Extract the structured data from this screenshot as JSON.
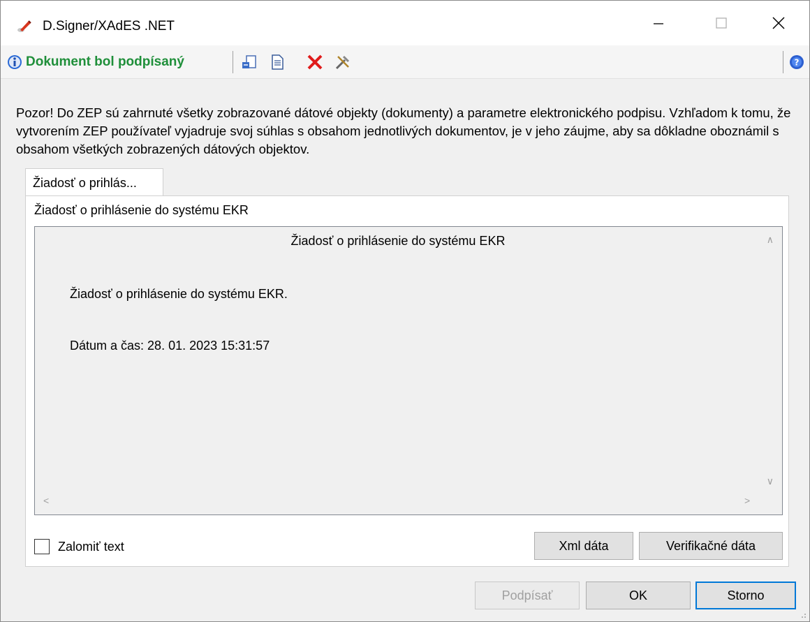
{
  "window": {
    "title": "D.Signer/XAdES .NET",
    "controls": {
      "minimize": "—",
      "maximize": "☐",
      "close": "✕"
    }
  },
  "toolbar": {
    "status_label": "Dokument bol podpísaný",
    "icons": [
      "import-icon",
      "document-icon",
      "delete-icon",
      "settings-icon",
      "help-icon"
    ]
  },
  "warning_text": "Pozor! Do ZEP sú zahrnuté všetky zobrazované dátové objekty (dokumenty) a parametre elektronického podpisu. Vzhľadom k tomu, že vytvorením ZEP používateľ vyjadruje svoj súhlas s obsahom jednotlivých dokumentov, je v jeho záujme, aby sa dôkladne oboznámil s obsahom všetkých zobrazených dátových objektov.",
  "tab": {
    "label": "Žiadosť o prihlás..."
  },
  "panel": {
    "label": "Žiadosť o prihlásenie do systému EKR",
    "viewer": {
      "title": "Žiadosť o prihlásenie do systému EKR",
      "line1": "Žiadosť o prihlásenie do systému EKR.",
      "line2": "Dátum a čas: 28. 01. 2023 15:31:57"
    },
    "wrap_checkbox": {
      "label": "Zalomiť text",
      "checked": false
    },
    "xml_button": "Xml dáta",
    "verification_button": "Verifikačné dáta"
  },
  "footer": {
    "sign_button": "Podpísať",
    "ok_button": "OK",
    "cancel_button": "Storno"
  },
  "colors": {
    "status_green": "#1f8f3a",
    "accent_blue": "#0078d7",
    "delete_red": "#e01b1b"
  }
}
